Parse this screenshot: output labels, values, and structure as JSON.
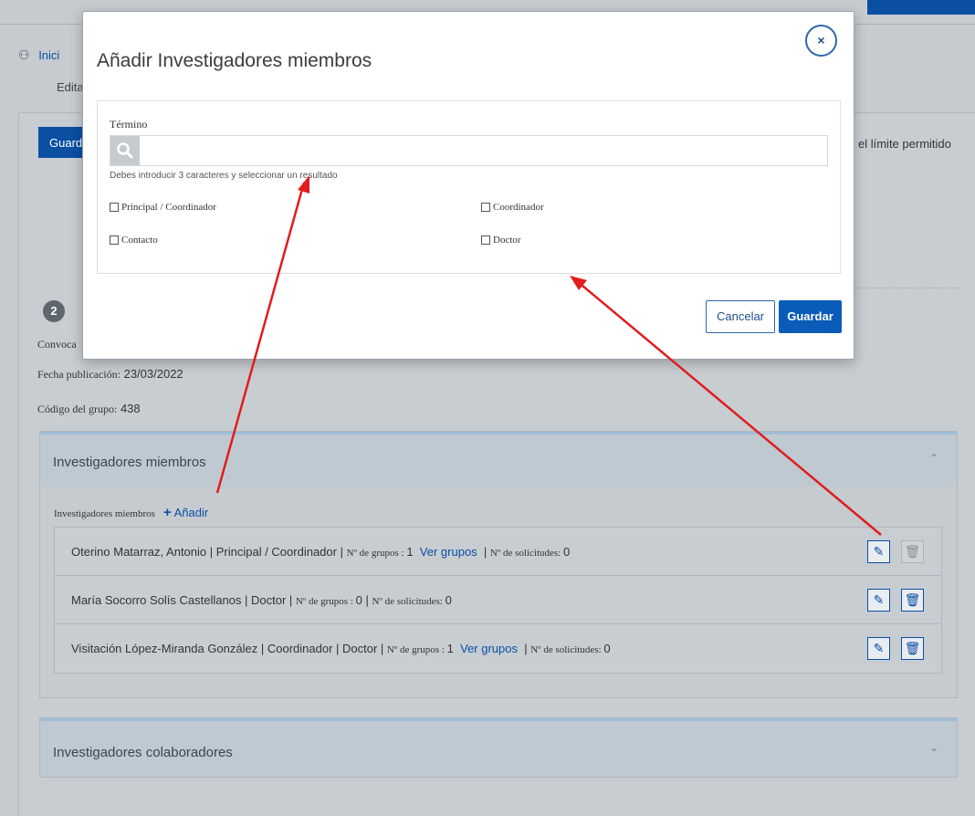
{
  "colors": {
    "accent": "#0b4fa3",
    "arrow": "#e11d1d",
    "overlay": "#c6cbd0"
  },
  "breadcrumb": {
    "icon": "users-icon",
    "link": "Inici",
    "sub": "Edita"
  },
  "background": {
    "save_button": "Guard",
    "limit_text": "el límite permitido",
    "step_number": "2",
    "convocatoria": "Convoca",
    "fecha_label": "Fecha publicación:",
    "fecha_value": "23/03/2022",
    "codigo_label": "Código del grupo:",
    "codigo_value": "438"
  },
  "members_panel": {
    "title": "Investigadores miembros",
    "label": "Investigadores miembros",
    "add_label": "Añadir",
    "rows": [
      {
        "name": "Oterino Matarraz, Antonio | Principal / Coordinador | ",
        "grupos_label": "Nº de grupos : ",
        "grupos_value": "1",
        "link": "Ver grupos",
        "solicitudes_label": "Nº de solicitudes: ",
        "solicitudes_value": "0"
      },
      {
        "name": "María Socorro Solís Castellanos | Doctor | ",
        "grupos_label": "Nº de grupos : ",
        "grupos_value": "0 | ",
        "link": "",
        "solicitudes_label": "Nº de solicitudes: ",
        "solicitudes_value": "0"
      },
      {
        "name": "Visitación López-Miranda González | Coordinador | Doctor | ",
        "grupos_label": "Nº de grupos : ",
        "grupos_value": "1",
        "link": "Ver grupos",
        "solicitudes_label": "Nº de solicitudes: ",
        "solicitudes_value": "0"
      }
    ]
  },
  "collab_panel": {
    "title": "Investigadores colaboradores"
  },
  "modal": {
    "title": "Añadir Investigadores miembros",
    "close_label": "×",
    "term_label": "Término",
    "search_value": "",
    "search_placeholder": "",
    "hint": "Debes introducir 3 caracteres y seleccionar un resultado",
    "checkboxes": [
      "Principal / Coordinador",
      "Coordinador",
      "Contacto",
      "Doctor"
    ],
    "cancel_label": "Cancelar",
    "save_label": "Guardar"
  }
}
